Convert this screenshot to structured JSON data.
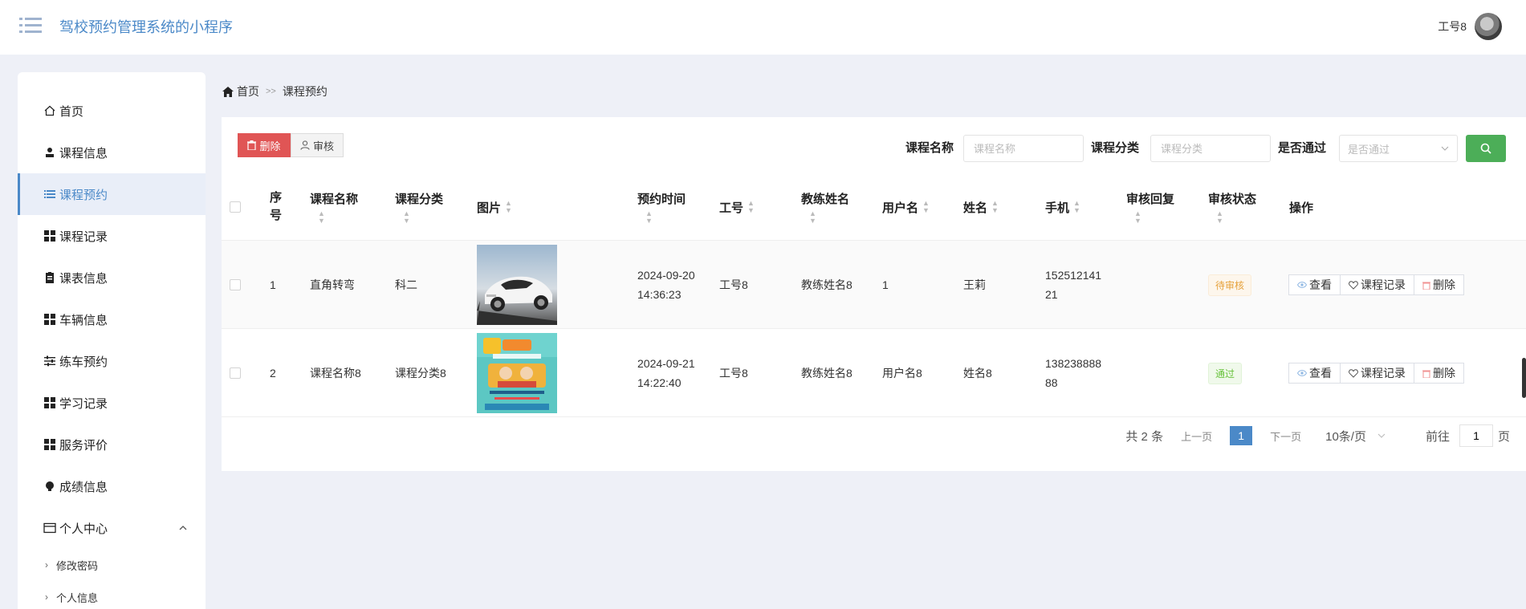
{
  "header": {
    "title": "驾校预约管理系统的小程序",
    "user_name": "工号8"
  },
  "sidebar": {
    "items": [
      {
        "label": "首页",
        "icon": "home-icon"
      },
      {
        "label": "课程信息",
        "icon": "user-icon"
      },
      {
        "label": "课程预约",
        "icon": "list-icon",
        "active": true
      },
      {
        "label": "课程记录",
        "icon": "grid-icon"
      },
      {
        "label": "课表信息",
        "icon": "clipboard-icon"
      },
      {
        "label": "车辆信息",
        "icon": "grid-icon"
      },
      {
        "label": "练车预约",
        "icon": "sliders-icon"
      },
      {
        "label": "学习记录",
        "icon": "grid-icon"
      },
      {
        "label": "服务评价",
        "icon": "grid-icon"
      },
      {
        "label": "成绩信息",
        "icon": "bulb-icon"
      },
      {
        "label": "个人中心",
        "icon": "wallet-icon",
        "expanded": true
      }
    ],
    "sub_items": [
      {
        "label": "修改密码"
      },
      {
        "label": "个人信息"
      }
    ]
  },
  "breadcrumb": {
    "home": "首页",
    "separator": ">>",
    "current": "课程预约"
  },
  "toolbar": {
    "delete_label": "删除",
    "audit_label": "审核"
  },
  "search": {
    "course_name_label": "课程名称",
    "course_name_placeholder": "课程名称",
    "course_category_label": "课程分类",
    "course_category_placeholder": "课程分类",
    "passed_label": "是否通过",
    "passed_placeholder": "是否通过"
  },
  "table": {
    "headers": {
      "index": "序号",
      "course_name": "课程名称",
      "course_category": "课程分类",
      "image": "图片",
      "booking_time": "预约时间",
      "staff_no": "工号",
      "coach_name": "教练姓名",
      "username": "用户名",
      "name": "姓名",
      "phone": "手机",
      "review_reply": "审核回复",
      "review_status": "审核状态",
      "actions": "操作"
    },
    "rows": [
      {
        "index": "1",
        "course_name": "直角转弯",
        "course_category": "科二",
        "booking_time_line1": "2024-09-20",
        "booking_time_line2": "14:36:23",
        "staff_no": "工号8",
        "coach_name": "教练姓名8",
        "username": "1",
        "name": "王莉",
        "phone_line1": "152512141",
        "phone_line2": "21",
        "review_reply": "",
        "review_status": "待审核",
        "status_type": "pending"
      },
      {
        "index": "2",
        "course_name": "课程名称8",
        "course_category": "课程分类8",
        "booking_time_line1": "2024-09-21",
        "booking_time_line2": "14:22:40",
        "staff_no": "工号8",
        "coach_name": "教练姓名8",
        "username": "用户名8",
        "name": "姓名8",
        "phone_line1": "138238888",
        "phone_line2": "88",
        "review_reply": "",
        "review_status": "通过",
        "status_type": "pass"
      }
    ],
    "action_labels": {
      "view": "查看",
      "record": "课程记录",
      "delete": "删除"
    }
  },
  "pagination": {
    "total": "共 2 条",
    "prev": "上一页",
    "current_page": "1",
    "next": "下一页",
    "page_size": "10条/页",
    "goto_label": "前往",
    "goto_value": "1",
    "page_suffix": "页"
  },
  "colors": {
    "accent": "#4b89c8",
    "danger": "#e05555",
    "success": "#4cae58"
  }
}
